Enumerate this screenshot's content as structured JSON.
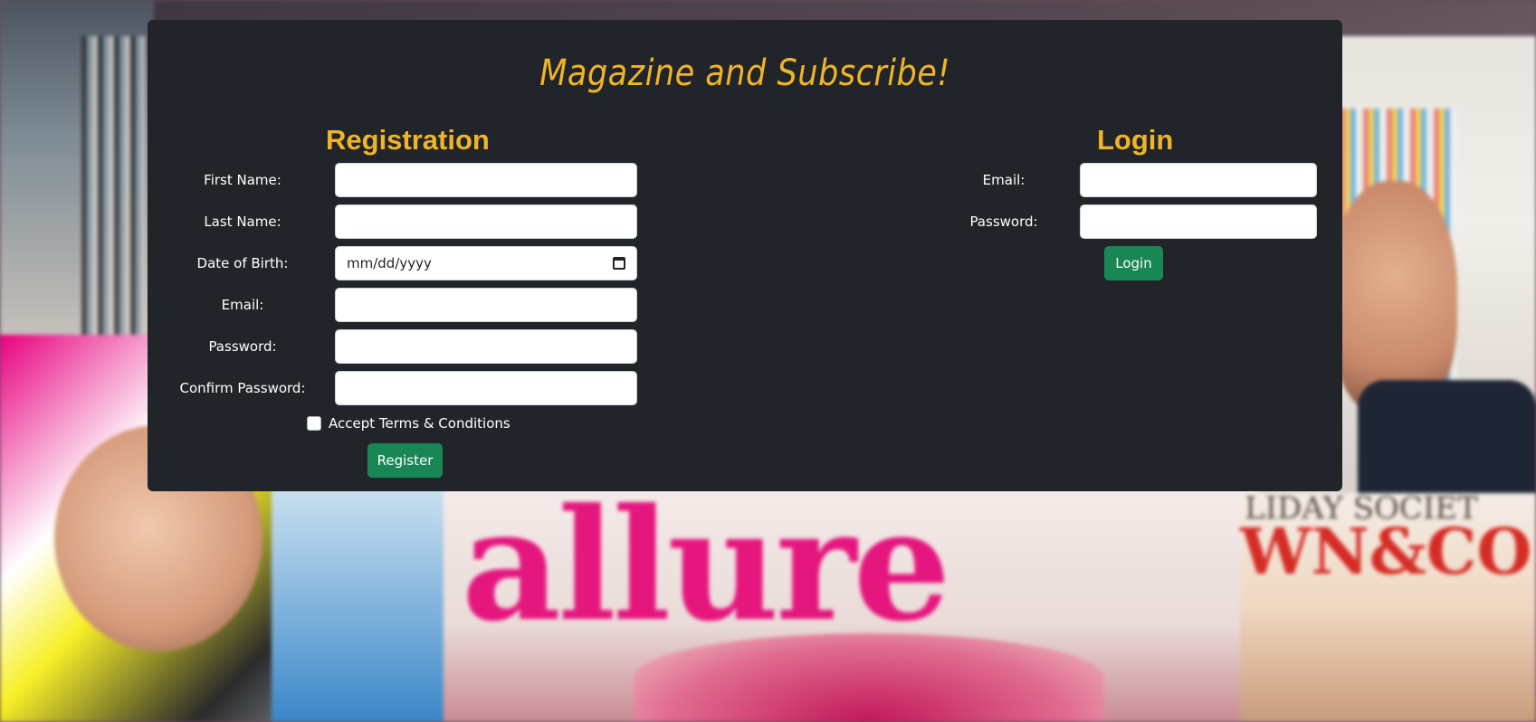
{
  "site": {
    "title": "Magazine and Subscribe!"
  },
  "registration": {
    "title": "Registration",
    "first_name_label": "First Name:",
    "last_name_label": "Last Name:",
    "dob_label": "Date of Birth:",
    "dob_placeholder": "mm/dd/yyyy",
    "email_label": "Email:",
    "password_label": "Password:",
    "confirm_password_label": "Confirm Password:",
    "terms_label": "Accept Terms & Conditions",
    "register_button": "Register"
  },
  "login": {
    "title": "Login",
    "email_label": "Email:",
    "password_label": "Password:",
    "login_button": "Login"
  },
  "background": {
    "magazine_text_1": "allure",
    "magazine_text_2": "WN&CO",
    "magazine_text_3": "LIDAY SOCIET"
  },
  "colors": {
    "panel": "#212529",
    "accent": "#f0b429",
    "button": "#198754"
  }
}
